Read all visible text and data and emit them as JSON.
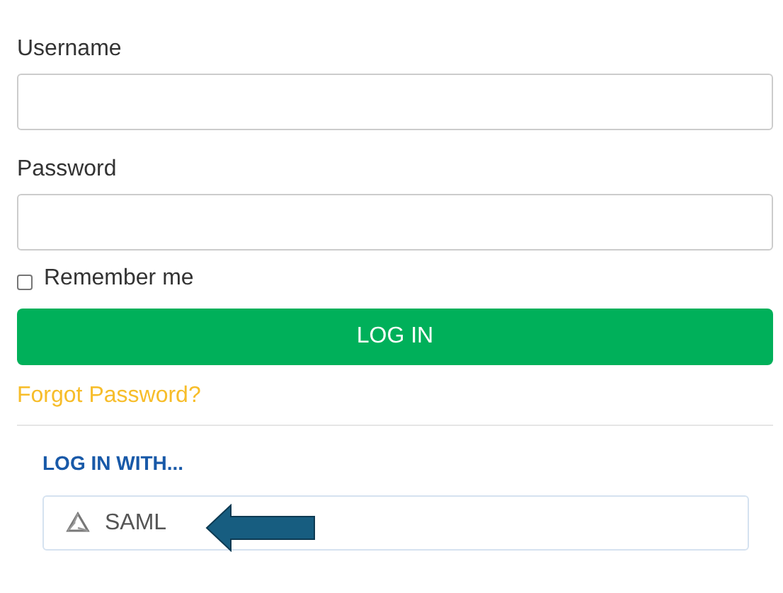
{
  "username": {
    "label": "Username"
  },
  "password": {
    "label": "Password"
  },
  "remember": {
    "label": "Remember me",
    "checked": false
  },
  "login_button": "LOG IN",
  "forgot_link": "Forgot Password?",
  "sso": {
    "heading": "LOG IN WITH...",
    "providers": [
      {
        "label": "SAML"
      }
    ]
  }
}
